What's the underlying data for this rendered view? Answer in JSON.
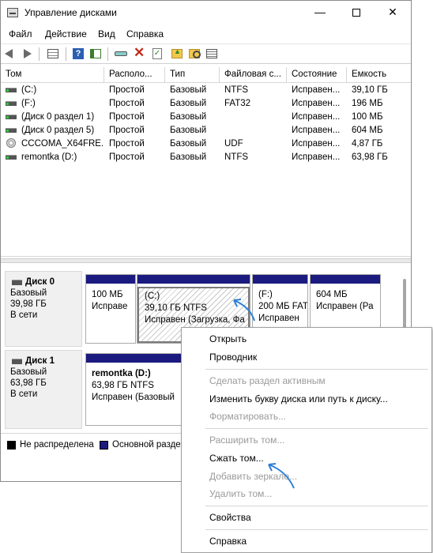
{
  "window": {
    "title": "Управление дисками",
    "minimize": "—",
    "close": "✕"
  },
  "menu": [
    "Файл",
    "Действие",
    "Вид",
    "Справка"
  ],
  "toolbar": {
    "icons": [
      "back-icon",
      "forward-icon",
      "volume-list-icon",
      "help-icon",
      "console-tree-icon",
      "connect-drive-icon",
      "delete-icon",
      "properties-icon",
      "open-icon",
      "explore-icon",
      "list-view-icon"
    ]
  },
  "volume_table": {
    "columns": [
      "Том",
      "Располо...",
      "Тип",
      "Файловая с...",
      "Состояние",
      "Емкость"
    ],
    "rows": [
      {
        "icon": "drive-icon",
        "name": "(C:)",
        "layout": "Простой",
        "type": "Базовый",
        "fs": "NTFS",
        "status": "Исправен...",
        "capacity": "39,10 ГБ"
      },
      {
        "icon": "drive-icon",
        "name": "(F:)",
        "layout": "Простой",
        "type": "Базовый",
        "fs": "FAT32",
        "status": "Исправен...",
        "capacity": "196 МБ"
      },
      {
        "icon": "drive-icon",
        "name": "(Диск 0 раздел 1)",
        "layout": "Простой",
        "type": "Базовый",
        "fs": "",
        "status": "Исправен...",
        "capacity": "100 МБ"
      },
      {
        "icon": "drive-icon",
        "name": "(Диск 0 раздел 5)",
        "layout": "Простой",
        "type": "Базовый",
        "fs": "",
        "status": "Исправен...",
        "capacity": "604 МБ"
      },
      {
        "icon": "cd-icon",
        "name": "CCCOMA_X64FRE...",
        "layout": "Простой",
        "type": "Базовый",
        "fs": "UDF",
        "status": "Исправен...",
        "capacity": "4,87 ГБ"
      },
      {
        "icon": "drive-icon",
        "name": "remontka (D:)",
        "layout": "Простой",
        "type": "Базовый",
        "fs": "NTFS",
        "status": "Исправен...",
        "capacity": "63,98 ГБ"
      }
    ]
  },
  "disks": [
    {
      "name": "Диск 0",
      "type": "Базовый",
      "size": "39,98 ГБ",
      "state": "В сети",
      "partitions": [
        {
          "title": "",
          "size": "100 МБ",
          "status": "Исправе",
          "hatched": false
        },
        {
          "title": "(C:)",
          "size": "39,10 ГБ NTFS",
          "status": "Исправен (Загрузка, Фа",
          "hatched": true
        },
        {
          "title": "(F:)",
          "size": "200 МБ FAT",
          "status": "Исправен",
          "hatched": false
        },
        {
          "title": "",
          "size": "604 МБ",
          "status": "Исправен (Ра",
          "hatched": false
        }
      ]
    },
    {
      "name": "Диск 1",
      "type": "Базовый",
      "size": "63,98 ГБ",
      "state": "В сети",
      "partitions": [
        {
          "title": "remontka  (D:)",
          "size": "63,98 ГБ NTFS",
          "status": "Исправен (Базовый",
          "hatched": false
        }
      ]
    }
  ],
  "legend": {
    "unallocated": "Не распределена",
    "primary": "Основной разде",
    "unallocated_color": "#000000",
    "primary_color": "#1b1a7e"
  },
  "context_menu": {
    "groups": [
      [
        {
          "label": "Открыть",
          "enabled": true
        },
        {
          "label": "Проводник",
          "enabled": true
        }
      ],
      [
        {
          "label": "Сделать раздел активным",
          "enabled": false
        },
        {
          "label": "Изменить букву диска или путь к диску...",
          "enabled": true
        },
        {
          "label": "Форматировать...",
          "enabled": false
        }
      ],
      [
        {
          "label": "Расширить том...",
          "enabled": false
        },
        {
          "label": "Сжать том...",
          "enabled": true
        },
        {
          "label": "Добавить зеркало...",
          "enabled": false
        },
        {
          "label": "Удалить том...",
          "enabled": false
        }
      ],
      [
        {
          "label": "Свойства",
          "enabled": true
        }
      ],
      [
        {
          "label": "Справка",
          "enabled": true
        }
      ]
    ]
  },
  "colors": {
    "partition_bar": "#1b1a7e",
    "annotation_arrow": "#2f7fd6"
  }
}
